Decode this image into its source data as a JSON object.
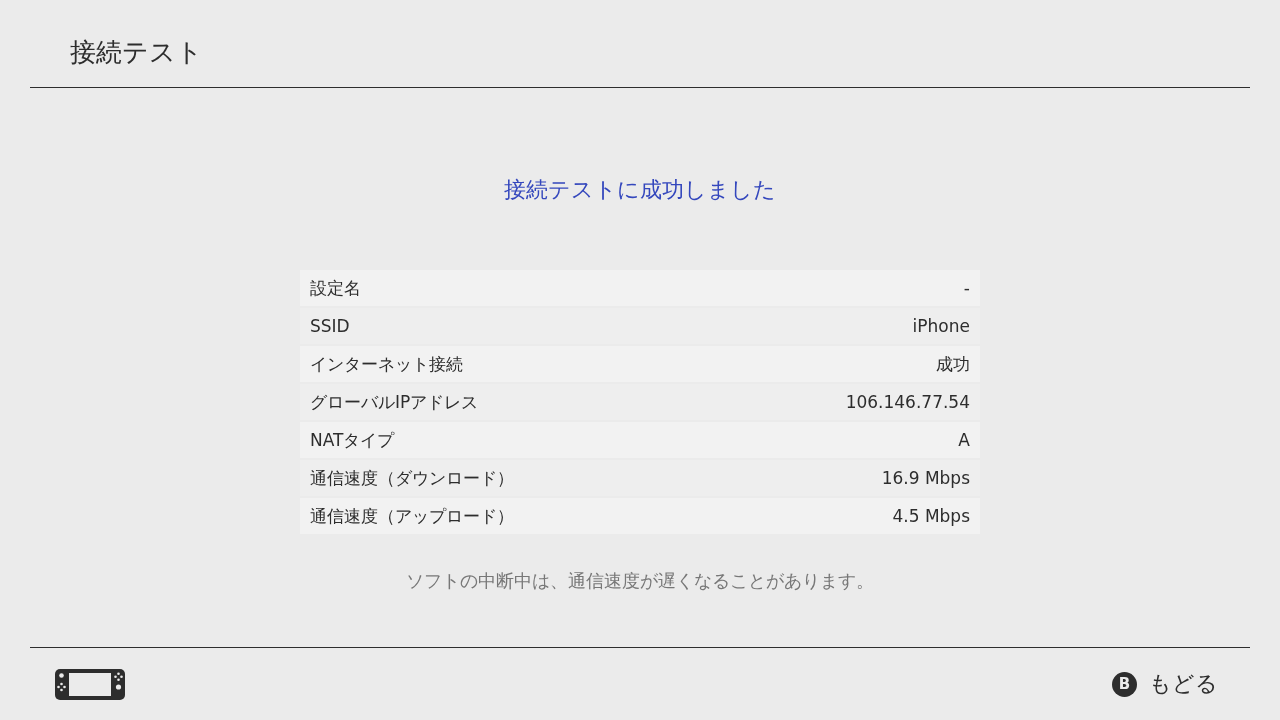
{
  "header": {
    "title": "接続テスト"
  },
  "result": {
    "message": "接続テストに成功しました"
  },
  "details": [
    {
      "label": "設定名",
      "value": "-"
    },
    {
      "label": "SSID",
      "value": "iPhone"
    },
    {
      "label": "インターネット接続",
      "value": "成功"
    },
    {
      "label": "グローバルIPアドレス",
      "value": "106.146.77.54"
    },
    {
      "label": "NATタイプ",
      "value": "A"
    },
    {
      "label": "通信速度（ダウンロード）",
      "value": "16.9 Mbps"
    },
    {
      "label": "通信速度（アップロード）",
      "value": "4.5 Mbps"
    }
  ],
  "note": "ソフトの中断中は、通信速度が遅くなることがあります。",
  "footer": {
    "back_button": {
      "key": "B",
      "label": "もどる"
    }
  }
}
